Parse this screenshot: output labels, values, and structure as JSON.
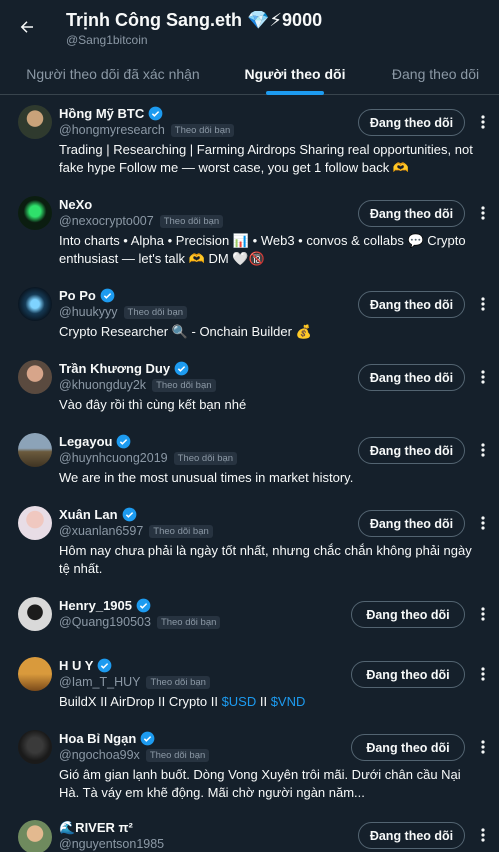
{
  "header": {
    "name": "Trịnh Công Sang.eth 💎⚡9000",
    "handle": "@Sang1bitcoin"
  },
  "tabs": [
    {
      "label": "Người theo dõi đã xác nhận",
      "active": false
    },
    {
      "label": "Người theo dõi",
      "active": true
    },
    {
      "label": "Đang theo dõi",
      "active": false
    }
  ],
  "colors": {
    "background": "#15202b",
    "accent": "#1d9bf0",
    "muted_text": "#8b98a5",
    "badge_bg": "#273340"
  },
  "follows_you_label": "Theo dõi bạn",
  "follow_button_label": "Đang theo dõi",
  "users": [
    {
      "name": "Hồng Mỹ BTC",
      "handle": "@hongmyresearch",
      "verified": true,
      "bio": "Trading | Researching | Farming Airdrops Sharing real opportunities, not fake hype Follow me — worst case, you get 1 follow back 🫶"
    },
    {
      "name": "NeXo",
      "handle": "@nexocrypto007",
      "verified": false,
      "bio": "Into charts • Alpha • Precision 📊 • Web3 • convos & collabs 💬 Crypto enthusiast — let's talk 🫶 DM 🤍🔞"
    },
    {
      "name": "Po Po",
      "handle": "@huukyyy",
      "verified": true,
      "bio": "Crypto Researcher 🔍 - Onchain Builder 💰"
    },
    {
      "name": "Trần Khương Duy",
      "handle": "@khuongduy2k",
      "verified": true,
      "bio": "Vào đây rồi thì cùng kết bạn nhé"
    },
    {
      "name": "Legayou",
      "handle": "@huynhcuong2019",
      "verified": true,
      "bio": "We are in the most unusual times in market history."
    },
    {
      "name": "Xuân Lan",
      "handle": "@xuanlan6597",
      "verified": true,
      "bio": "Hôm nay chưa phải là ngày tốt nhất, nhưng chắc chắn không phải ngày tệ nhất."
    },
    {
      "name": "Henry_1905",
      "handle": "@Quang190503",
      "verified": true,
      "bio": ""
    },
    {
      "name": "H U Y",
      "handle": "@Iam_T_HUY",
      "verified": true,
      "bio_prefix": "BuildX II AirDrop II Crypto II ",
      "bio_link1": "$USD",
      "bio_mid": " II ",
      "bio_link2": "$VND"
    },
    {
      "name": "Hoa Bỉ Ngạn",
      "handle": "@ngochoa99x",
      "verified": true,
      "bio": "Gió âm gian lạnh buốt. Dòng Vong Xuyên trôi mãi. Dưới chân cầu Nại Hà. Tà váy em khẽ động. Mãi chờ người ngàn năm..."
    },
    {
      "name": "🌊RIVER π²",
      "handle": "@nguyentson1985",
      "verified": false,
      "bio": ""
    }
  ]
}
